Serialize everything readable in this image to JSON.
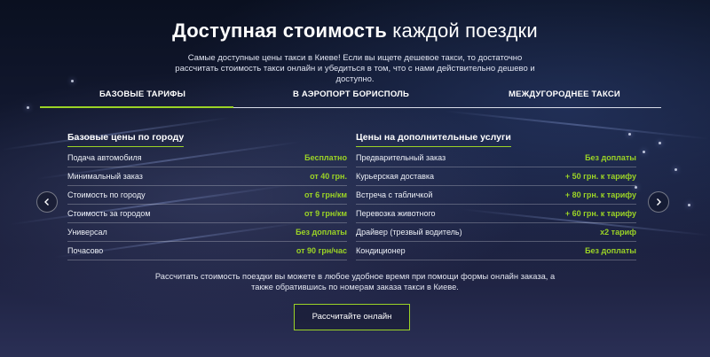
{
  "section": {
    "title_bold": "Доступная стоимость",
    "title_light": "каждой поездки",
    "intro": "Самые доступные цены такси в Киеве! Если вы ищете дешевое такси, то достаточно рассчитать стоимость такси онлайн и убедиться в том, что с нами действительно дешево и доступно."
  },
  "tabs": [
    {
      "label": "БАЗОВЫЕ ТАРИФЫ",
      "active": true
    },
    {
      "label": "В АЭРОПОРТ БОРИСПОЛЬ",
      "active": false
    },
    {
      "label": "МЕЖДУГОРОДНЕЕ ТАКСИ",
      "active": false
    }
  ],
  "base_prices": {
    "title": "Базовые цены по городу",
    "rows": [
      {
        "label": "Подача автомобиля",
        "value": "Бесплатно"
      },
      {
        "label": "Минимальный заказ",
        "value": "от 40 грн."
      },
      {
        "label": "Стоимость по городу",
        "value": "от 6 грн/км"
      },
      {
        "label": "Стоимость за городом",
        "value": "от 9 грн/км"
      },
      {
        "label": "Универсал",
        "value": "Без доплаты"
      },
      {
        "label": "Почасово",
        "value": "от 90 грн/час"
      }
    ]
  },
  "extra_services": {
    "title": "Цены на дополнительные услуги",
    "rows": [
      {
        "label": "Предварительный заказ",
        "value": "Без доплаты"
      },
      {
        "label": "Курьерская доставка",
        "value": "+ 50 грн. к тарифу"
      },
      {
        "label": "Встреча с табличкой",
        "value": "+ 80 грн. к тарифу"
      },
      {
        "label": "Перевозка животного",
        "value": "+ 60 грн. к тарифу"
      },
      {
        "label": "Драйвер (трезвый водитель)",
        "value": "x2 тариф"
      },
      {
        "label": "Кондиционер",
        "value": "Без доплаты"
      }
    ]
  },
  "footer": {
    "text": "Рассчитать стоимость поездки вы можете в любое удобное время при помощи формы онлайн заказа, а также обратившись по номерам заказа такси в Киеве.",
    "cta_label": "Рассчитайте онлайн"
  },
  "colors": {
    "accent": "#9bd326",
    "background": "#141a33"
  },
  "icons": {
    "prev": "chevron-left-icon",
    "next": "chevron-right-icon"
  }
}
